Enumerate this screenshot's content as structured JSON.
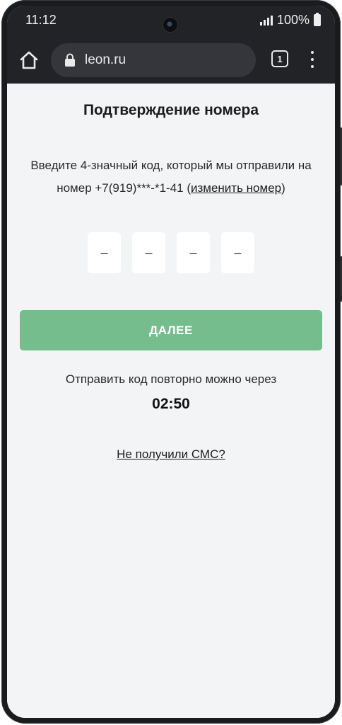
{
  "status_bar": {
    "time": "11:12",
    "battery": "100%"
  },
  "browser": {
    "url": "leon.ru",
    "tab_count": "1",
    "icons": [
      "home-icon",
      "lock-icon",
      "tabs-icon",
      "more-vert-icon"
    ]
  },
  "page": {
    "title": "Подтверждение номера",
    "description_prefix": "Введите 4-значный код, который мы отправили на номер +7(919)***-*1-41 (",
    "change_number_link": "изменить номер",
    "description_suffix": ")",
    "code_placeholders": [
      "–",
      "–",
      "–",
      "–"
    ],
    "next_button": "ДАЛЕЕ",
    "resend_text": "Отправить код повторно можно через",
    "timer": "02:50",
    "no_sms_link": "Не получили СМС?"
  },
  "colors": {
    "button_green": "#76bd8e",
    "page_background": "#f3f4f5",
    "browser_bar": "#222326"
  }
}
